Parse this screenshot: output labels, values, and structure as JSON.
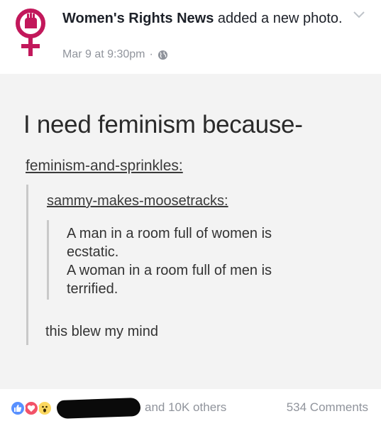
{
  "post": {
    "page_name": "Women's Rights News",
    "action": " added a new photo.",
    "timestamp": "Mar 9 at 9:30pm",
    "separator": "·",
    "privacy_icon": "globe-icon"
  },
  "photo": {
    "title": "I need feminism because-",
    "user1": "feminism-and-sprinkles:",
    "user2": "sammy-makes-moosetracks:",
    "quote_lines": [
      "A man in a room full of women is",
      "ecstatic.",
      "A woman in a room full of men is",
      "terrified."
    ],
    "footnote": "this blew my mind"
  },
  "reactions": {
    "icons": [
      "like-icon",
      "love-icon",
      "wow-icon"
    ],
    "others_text": "and 10K others",
    "comments_text": "534 Comments"
  },
  "colors": {
    "brand_pink": "#c2185b",
    "meta_gray": "#90949c",
    "like_blue": "#5890ff",
    "love_red": "#f25268",
    "wow_yellow": "#fcd860"
  }
}
